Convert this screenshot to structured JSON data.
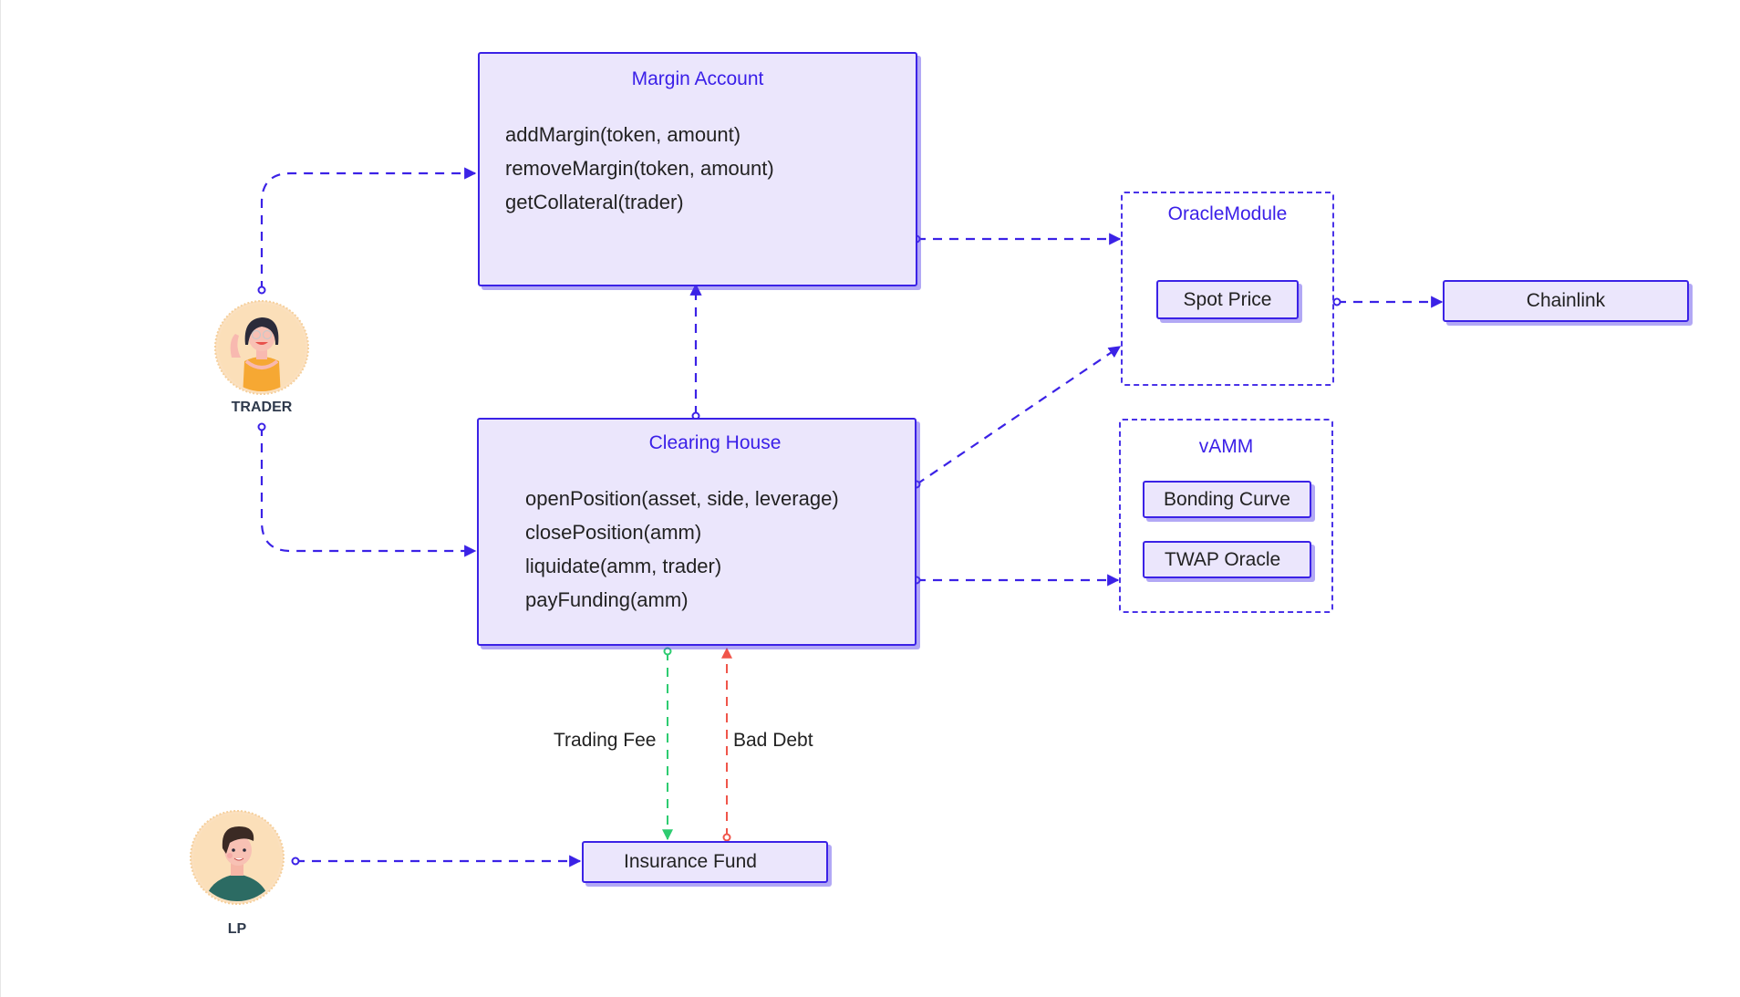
{
  "diagram": {
    "accent_color": "#3b22e6",
    "fee_color": "#2ecc71",
    "debt_color": "#f0554a",
    "actors": {
      "trader": {
        "label": "TRADER",
        "icon": "trader-avatar-icon"
      },
      "lp": {
        "label": "LP",
        "icon": "lp-avatar-icon"
      }
    },
    "margin_account": {
      "title": "Margin Account",
      "methods": [
        "addMargin(token, amount)",
        "removeMargin(token, amount)",
        "getCollateral(trader)"
      ]
    },
    "clearing_house": {
      "title": "Clearing House",
      "methods": [
        "openPosition(asset, side, leverage)",
        "closePosition(amm)",
        "liquidate(amm, trader)",
        "payFunding(amm)"
      ]
    },
    "oracle_module": {
      "title": "OracleModule",
      "components": [
        "Spot Price"
      ]
    },
    "vamm": {
      "title": "vAMM",
      "components": [
        "Bonding Curve",
        "TWAP Oracle"
      ]
    },
    "chainlink": {
      "label": "Chainlink"
    },
    "insurance_fund": {
      "label": "Insurance Fund"
    },
    "edges": {
      "trading_fee": "Trading Fee",
      "bad_debt": "Bad Debt"
    }
  }
}
